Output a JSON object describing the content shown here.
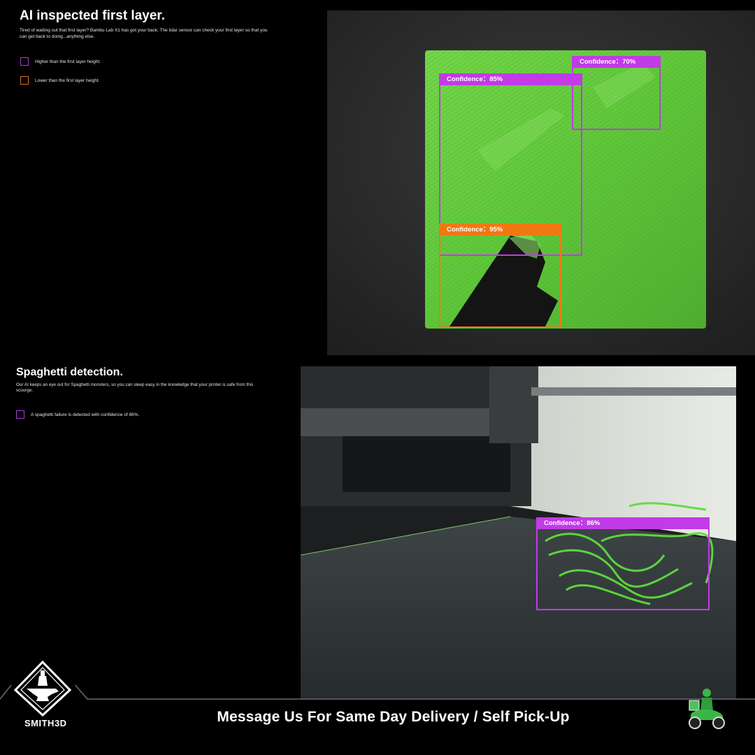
{
  "section1": {
    "title": "AI inspected first layer.",
    "description": "Tired of waiting out that first layer? Bambu Lab X1 has got your back. The lidar sensor can check your first layer so that you can get back to doing...anything else.",
    "legend": [
      {
        "label": "Higher than the first layer height.",
        "color": "#b23ad6"
      },
      {
        "label": "Lower than the first layer height.",
        "color": "#e8700d"
      }
    ],
    "detections": [
      {
        "label": "Confidence：85%",
        "color": "#c13be6"
      },
      {
        "label": "Confidence：70%",
        "color": "#c13be6"
      },
      {
        "label": "Confidence：95%",
        "color": "#f07812"
      }
    ]
  },
  "section2": {
    "title": "Spaghetti detection.",
    "description": "Our AI keeps an eye out for Spaghetti monsters, so you can sleep easy in the knowledge that your printer is safe from this scourge.",
    "legend": [
      {
        "label": "A spaghetti failure is detected with confidence of 86%.",
        "color": "#b23ad6"
      }
    ],
    "detections": [
      {
        "label": "Confidence：86%",
        "color": "#c13be6"
      }
    ]
  },
  "footer": {
    "cta": "Message Us For Same Day Delivery / Self Pick-Up",
    "brand": "SMITH3D"
  },
  "icons": [
    "anvil-logo-icon",
    "delivery-rider-icon"
  ]
}
